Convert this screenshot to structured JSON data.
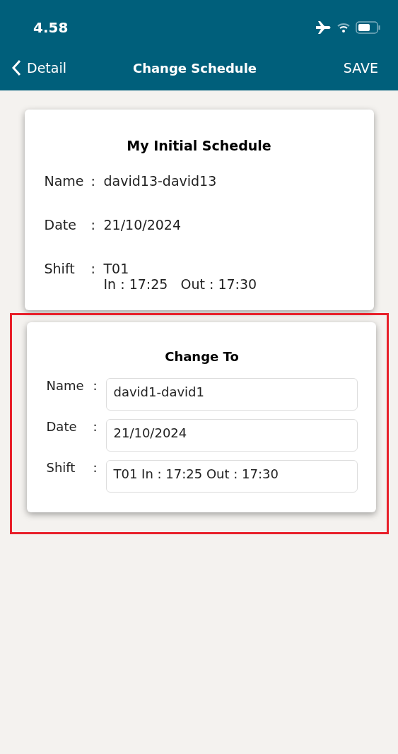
{
  "status_bar": {
    "time": "4.58"
  },
  "nav": {
    "back": "Detail",
    "title": "Change Schedule",
    "action": "SAVE"
  },
  "initial": {
    "title": "My Initial Schedule",
    "rows": [
      {
        "label": "Name",
        "separator": ":",
        "lines": [
          "david13-david13"
        ]
      },
      {
        "label": "Date",
        "separator": ":",
        "lines": [
          "21/10/2024"
        ]
      },
      {
        "label": "Shift",
        "separator": ":",
        "lines": [
          "T01",
          "In : 17:25   Out : 17:30"
        ]
      }
    ]
  },
  "change_to": {
    "title": "Change To",
    "highlighted": true,
    "fields": [
      {
        "label": "Name",
        "separator": ":",
        "value": "david1-david1"
      },
      {
        "label": "Date",
        "separator": ":",
        "value": "21/10/2024"
      },
      {
        "label": "Shift",
        "separator": ":",
        "value": "T01 In : 17:25 Out : 17:30"
      }
    ]
  }
}
